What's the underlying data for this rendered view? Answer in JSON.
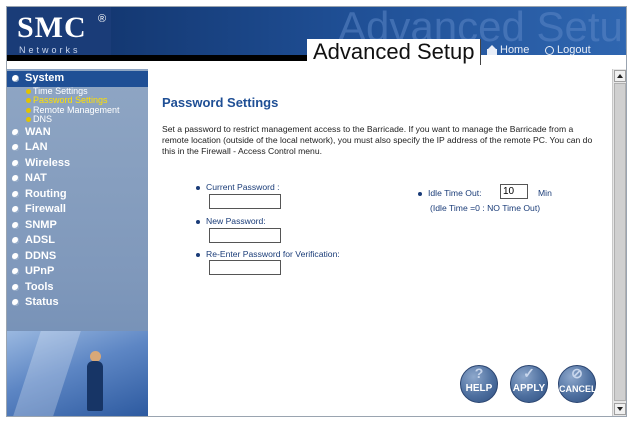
{
  "brand": {
    "logo": "SMC",
    "reg_mark": "®",
    "sub": "Networks",
    "watermark": "Advanced Setup"
  },
  "header": {
    "title": "Advanced Setup",
    "home": "Home",
    "logout": "Logout"
  },
  "sidebar": {
    "items": [
      {
        "label": "System",
        "active": true
      },
      {
        "label": "WAN"
      },
      {
        "label": "LAN"
      },
      {
        "label": "Wireless"
      },
      {
        "label": "NAT"
      },
      {
        "label": "Routing"
      },
      {
        "label": "Firewall"
      },
      {
        "label": "SNMP"
      },
      {
        "label": "ADSL"
      },
      {
        "label": "DDNS"
      },
      {
        "label": "UPnP"
      },
      {
        "label": "Tools"
      },
      {
        "label": "Status"
      }
    ],
    "system_sub": [
      {
        "label": "Time Settings"
      },
      {
        "label": "Password Settings",
        "current": true
      },
      {
        "label": "Remote Management"
      },
      {
        "label": "DNS"
      }
    ]
  },
  "main": {
    "section_title": "Password Settings",
    "description": "Set a password to restrict management access to the Barricade. If you want to manage the Barricade from a remote location (outside of the local network), you must also specify the IP address of the remote PC. You can do this in the Firewall - Access Control menu.",
    "fields": {
      "current_password_label": "Current Password :",
      "current_password_value": "",
      "new_password_label": "New Password:",
      "new_password_value": "",
      "reenter_label": "Re-Enter Password for Verification:",
      "reenter_value": "",
      "idle_label": "Idle Time Out:",
      "idle_value": "10",
      "idle_unit": "Min",
      "idle_note": "(Idle Time =0 : NO Time Out)"
    },
    "buttons": {
      "help": "HELP",
      "apply": "APPLY",
      "cancel": "CANCEL"
    }
  },
  "colors": {
    "brand_blue": "#1f4f95",
    "sidebar": "#8fa6c4",
    "current_sub": "#ffe000"
  },
  "icons": [
    "home-icon",
    "logout-icon",
    "help-icon",
    "apply-icon",
    "cancel-icon"
  ]
}
